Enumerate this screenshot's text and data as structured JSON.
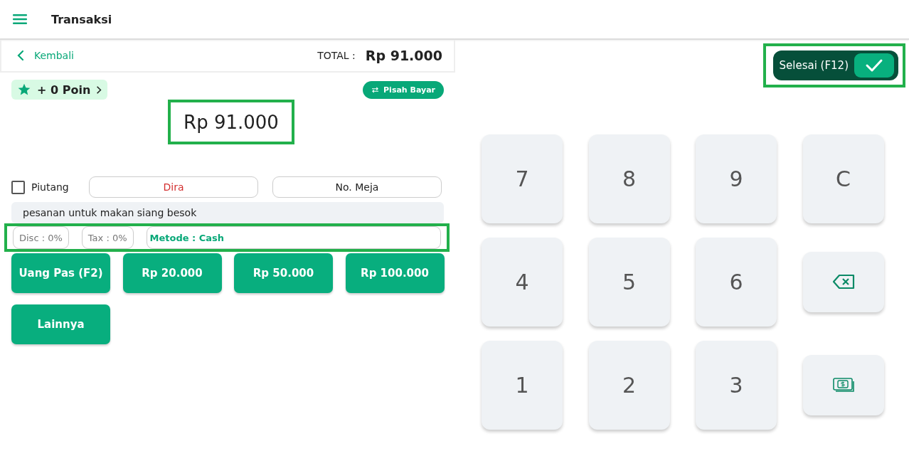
{
  "app_bar": {
    "title": "Transaksi"
  },
  "summary": {
    "back": "Kembali",
    "total_label": "TOTAL :",
    "total_value": "Rp 91.000"
  },
  "points": {
    "label": "+ 0 Poin"
  },
  "split_button": "Pisah Bayar",
  "amount": "Rp 91.000",
  "debt": {
    "label": "Piutang",
    "checked": false
  },
  "customer": "Dira",
  "table_field": {
    "placeholder": "No. Meja"
  },
  "note": "pesanan untuk makan siang besok",
  "discount": "Disc : 0%",
  "tax": "Tax : 0%",
  "method": "Metode : Cash",
  "quick_amounts": [
    "Uang Pas (F2)",
    "Rp 20.000",
    "Rp 50.000",
    "Rp 100.000"
  ],
  "other_button": "Lainnya",
  "finish_button": "Selesai (F12)",
  "keypad": [
    {
      "kind": "digit",
      "label": "7"
    },
    {
      "kind": "digit",
      "label": "8"
    },
    {
      "kind": "digit",
      "label": "9"
    },
    {
      "kind": "clear",
      "label": "C"
    },
    {
      "kind": "digit",
      "label": "4"
    },
    {
      "kind": "digit",
      "label": "5"
    },
    {
      "kind": "digit",
      "label": "6"
    },
    {
      "kind": "backspace"
    },
    {
      "kind": "digit",
      "label": "1"
    },
    {
      "kind": "digit",
      "label": "2"
    },
    {
      "kind": "digit",
      "label": "3"
    },
    {
      "kind": "cash"
    }
  ]
}
